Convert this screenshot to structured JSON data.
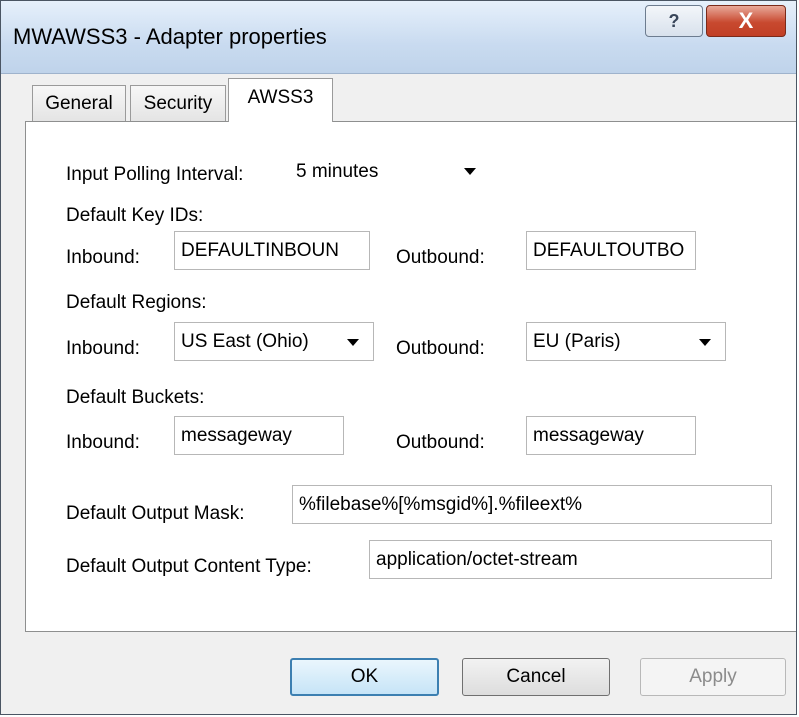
{
  "window": {
    "title": "MWAWSS3 - Adapter properties",
    "help_glyph": "?",
    "close_glyph": "X"
  },
  "tabs": [
    {
      "label": "General"
    },
    {
      "label": "Security"
    },
    {
      "label": "AWSS3",
      "selected": true
    }
  ],
  "form": {
    "polling": {
      "label": "Input Polling Interval:",
      "value": "5 minutes"
    },
    "key_ids": {
      "heading": "Default Key IDs:",
      "inbound_label": "Inbound:",
      "inbound_value": "DEFAULTINBOUN",
      "outbound_label": "Outbound:",
      "outbound_value": "DEFAULTOUTBO"
    },
    "regions": {
      "heading": "Default Regions:",
      "inbound_label": "Inbound:",
      "inbound_value": "US East (Ohio)",
      "outbound_label": "Outbound:",
      "outbound_value": "EU (Paris)"
    },
    "buckets": {
      "heading": "Default Buckets:",
      "inbound_label": "Inbound:",
      "inbound_value": "messageway",
      "outbound_label": "Outbound:",
      "outbound_value": "messageway"
    },
    "output_mask": {
      "label": "Default Output Mask:",
      "value": "%filebase%[%msgid%].%fileext%"
    },
    "content_type": {
      "label": "Default Output Content Type:",
      "value": "application/octet-stream"
    }
  },
  "buttons": {
    "ok": "OK",
    "cancel": "Cancel",
    "apply": "Apply"
  }
}
